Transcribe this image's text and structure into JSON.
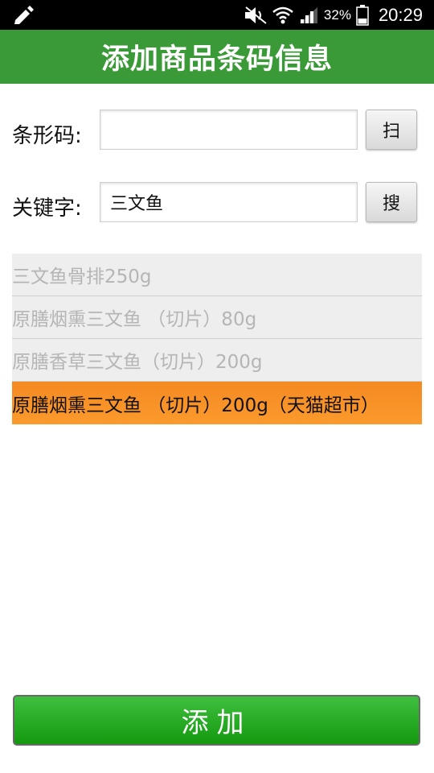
{
  "status_bar": {
    "battery_percent": "32%",
    "time": "20:29",
    "icons": [
      "edit-icon",
      "mute-icon",
      "wifi-icon",
      "signal-icon",
      "battery-icon"
    ]
  },
  "header": {
    "title": "添加商品条码信息"
  },
  "form": {
    "barcode_label": "条形码:",
    "barcode_value": "",
    "scan_button": "扫",
    "keyword_label": "关键字:",
    "keyword_value": "三文鱼",
    "search_button": "搜"
  },
  "results": {
    "items": [
      "三文鱼骨排250g",
      "原膳烟熏三文鱼 （切片）80g",
      "原膳香草三文鱼（切片）200g",
      "原膳烟熏三文鱼 （切片）200g（天猫超市）"
    ],
    "selected_index": 3
  },
  "footer": {
    "add_button": "添加"
  },
  "colors": {
    "status_bar": "#000000",
    "header": "#3a9a37",
    "selected_row": "#f7901f",
    "add_button": "#1fa81c"
  }
}
